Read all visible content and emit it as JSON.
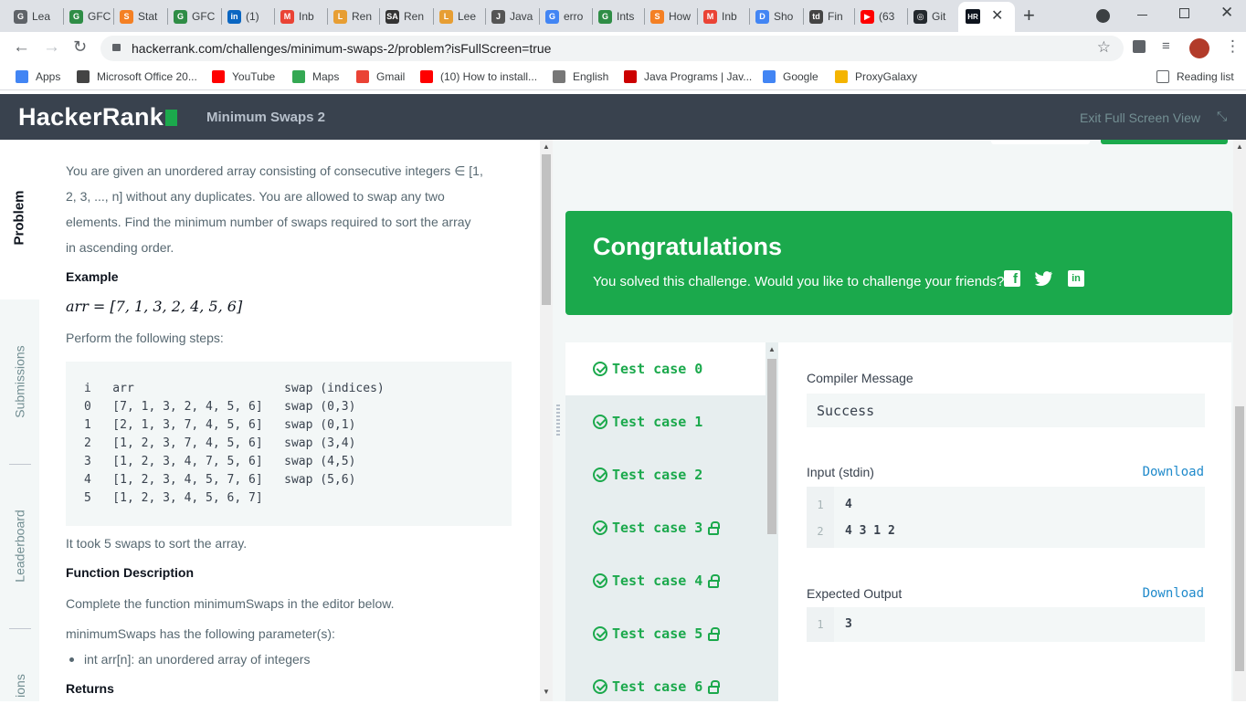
{
  "browser": {
    "tabs": [
      {
        "label": "Lea",
        "color": "#5f6368",
        "glyph": "G"
      },
      {
        "label": "GFC",
        "color": "#2f8d46",
        "glyph": "G"
      },
      {
        "label": "Stat",
        "color": "#f48024",
        "glyph": "S"
      },
      {
        "label": "GFC",
        "color": "#2f8d46",
        "glyph": "G"
      },
      {
        "label": "(1)",
        "color": "#0a66c2",
        "glyph": "in"
      },
      {
        "label": "Inb",
        "color": "#ea4335",
        "glyph": "M"
      },
      {
        "label": "Ren",
        "color": "#e79e33",
        "glyph": "L"
      },
      {
        "label": "Ren",
        "color": "#333333",
        "glyph": "SA"
      },
      {
        "label": "Lee",
        "color": "#e79e33",
        "glyph": "L"
      },
      {
        "label": "Java",
        "color": "#555555",
        "glyph": "J"
      },
      {
        "label": "erro",
        "color": "#4285f4",
        "glyph": "G"
      },
      {
        "label": "Ints",
        "color": "#2f8d46",
        "glyph": "G"
      },
      {
        "label": "How",
        "color": "#f48024",
        "glyph": "S"
      },
      {
        "label": "Inb",
        "color": "#ea4335",
        "glyph": "M"
      },
      {
        "label": "Sho",
        "color": "#4285f4",
        "glyph": "D"
      },
      {
        "label": "Fin",
        "color": "#444444",
        "glyph": "td"
      },
      {
        "label": "(63",
        "color": "#ff0000",
        "glyph": "▶"
      },
      {
        "label": "Git",
        "color": "#24292e",
        "glyph": "◎"
      }
    ],
    "active_tab_glyph": "HR",
    "url": "hackerrank.com/challenges/minimum-swaps-2/problem?isFullScreen=true",
    "bookmarks": [
      {
        "label": "Apps",
        "color": "#4285f4"
      },
      {
        "label": "Microsoft Office 20...",
        "color": "#444444"
      },
      {
        "label": "YouTube",
        "color": "#ff0000"
      },
      {
        "label": "Maps",
        "color": "#34a853"
      },
      {
        "label": "Gmail",
        "color": "#ea4335"
      },
      {
        "label": "(10) How to install...",
        "color": "#ff0000"
      },
      {
        "label": "English",
        "color": "#777777"
      },
      {
        "label": "Java Programs | Jav...",
        "color": "#cc0000"
      },
      {
        "label": "Google",
        "color": "#4285f4"
      },
      {
        "label": "ProxyGalaxy",
        "color": "#f4b400"
      }
    ],
    "reading_list": "Reading list"
  },
  "header": {
    "logo": "HackerRank",
    "challenge_title": "Minimum Swaps 2",
    "exit_fullscreen": "Exit Full Screen View"
  },
  "side_tabs": {
    "problem": "Problem",
    "submissions": "Submissions",
    "leaderboard": "Leaderboard",
    "discussions": "ions"
  },
  "problem": {
    "intro_lines": [
      "You are given an unordered array consisting of consecutive integers ∈ [1,",
      "2, 3, ..., n] without any duplicates. You are allowed to swap any two",
      "elements. Find the minimum number of swaps required to sort the array",
      "in ascending order."
    ],
    "example_heading": "Example",
    "example_expr": "arr = [7, 1, 3, 2, 4, 5, 6]",
    "steps_label": "Perform the following steps:",
    "code": "i   arr                     swap (indices)\n0   [7, 1, 3, 2, 4, 5, 6]   swap (0,3)\n1   [2, 1, 3, 7, 4, 5, 6]   swap (0,1)\n2   [1, 2, 3, 7, 4, 5, 6]   swap (3,4)\n3   [1, 2, 3, 4, 7, 5, 6]   swap (4,5)\n4   [1, 2, 3, 4, 5, 7, 6]   swap (5,6)\n5   [1, 2, 3, 4, 5, 6, 7]",
    "took_text": "It took 5 swaps to sort the array.",
    "function_heading": "Function Description",
    "function_text": "Complete the function minimumSwaps in the editor below.",
    "params_text": "minimumSwaps has the following parameter(s):",
    "param_item": "int arr[n]: an unordered array of integers",
    "returns_heading": "Returns"
  },
  "congrats": {
    "title": "Congratulations",
    "message": "You solved this challenge. Would you like to challenge your friends?",
    "share_icons": [
      "facebook-icon",
      "twitter-icon",
      "linkedin-icon"
    ]
  },
  "test_cases": [
    {
      "label": "Test case 0",
      "locked": false,
      "active": true
    },
    {
      "label": "Test case 1",
      "locked": false,
      "active": false
    },
    {
      "label": "Test case 2",
      "locked": false,
      "active": false
    },
    {
      "label": "Test case 3",
      "locked": true,
      "active": false
    },
    {
      "label": "Test case 4",
      "locked": true,
      "active": false
    },
    {
      "label": "Test case 5",
      "locked": true,
      "active": false
    },
    {
      "label": "Test case 6",
      "locked": true,
      "active": false
    }
  ],
  "detail": {
    "compiler_label": "Compiler Message",
    "compiler_value": "Success",
    "input_label": "Input (stdin)",
    "input_download": "Download",
    "input_lines": [
      {
        "n": "1",
        "v": "4"
      },
      {
        "n": "2",
        "v": "4 3 1 2"
      }
    ],
    "output_label": "Expected Output",
    "output_download": "Download",
    "output_lines": [
      {
        "n": "1",
        "v": "3"
      }
    ]
  },
  "colors": {
    "hr_green": "#1ba94c",
    "header_bg": "#39424e",
    "link_blue": "#1f8acb"
  }
}
